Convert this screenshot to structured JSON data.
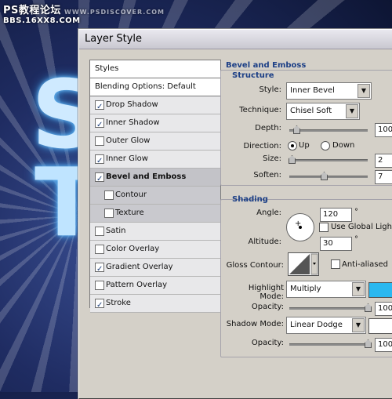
{
  "watermark": {
    "title": "PS教程论坛",
    "sub": "BBS.16XX8.COM",
    "url": "WWW.PSDISCOVER.COM"
  },
  "background": {
    "letter1": "S",
    "letter2": "T"
  },
  "dialog": {
    "title": "Layer Style"
  },
  "left_panel": {
    "header": "Styles",
    "blending": "Blending Options: Default",
    "items": [
      {
        "label": "Drop Shadow",
        "checked": true
      },
      {
        "label": "Inner Shadow",
        "checked": true
      },
      {
        "label": "Outer Glow",
        "checked": false
      },
      {
        "label": "Inner Glow",
        "checked": true
      },
      {
        "label": "Bevel and Emboss",
        "checked": true,
        "selected": true
      },
      {
        "label": "Contour",
        "checked": false,
        "sub": true
      },
      {
        "label": "Texture",
        "checked": false,
        "sub": true
      },
      {
        "label": "Satin",
        "checked": false
      },
      {
        "label": "Color Overlay",
        "checked": false
      },
      {
        "label": "Gradient Overlay",
        "checked": true
      },
      {
        "label": "Pattern Overlay",
        "checked": false
      },
      {
        "label": "Stroke",
        "checked": true
      }
    ]
  },
  "bevel": {
    "title": "Bevel and Emboss",
    "structure": {
      "title": "Structure",
      "style_label": "Style:",
      "style_value": "Inner Bevel",
      "technique_label": "Technique:",
      "technique_value": "Chisel Soft",
      "depth_label": "Depth:",
      "depth_value": "100",
      "direction_label": "Direction:",
      "up_label": "Up",
      "down_label": "Down",
      "size_label": "Size:",
      "size_value": "2",
      "soften_label": "Soften:",
      "soften_value": "7"
    },
    "shading": {
      "title": "Shading",
      "angle_label": "Angle:",
      "angle_value": "120",
      "degree": "°",
      "global_light_label": "Use Global Light",
      "altitude_label": "Altitude:",
      "altitude_value": "30",
      "gloss_label": "Gloss Contour:",
      "antialiased_label": "Anti-aliased",
      "highlight_label": "Highlight Mode:",
      "highlight_value": "Multiply",
      "highlight_color": "#2ab8f0",
      "opacity_label": "Opacity:",
      "highlight_opacity": "100",
      "shadow_label": "Shadow Mode:",
      "shadow_value": "Linear Dodge",
      "shadow_color": "#ffffff",
      "shadow_opacity": "100"
    }
  }
}
